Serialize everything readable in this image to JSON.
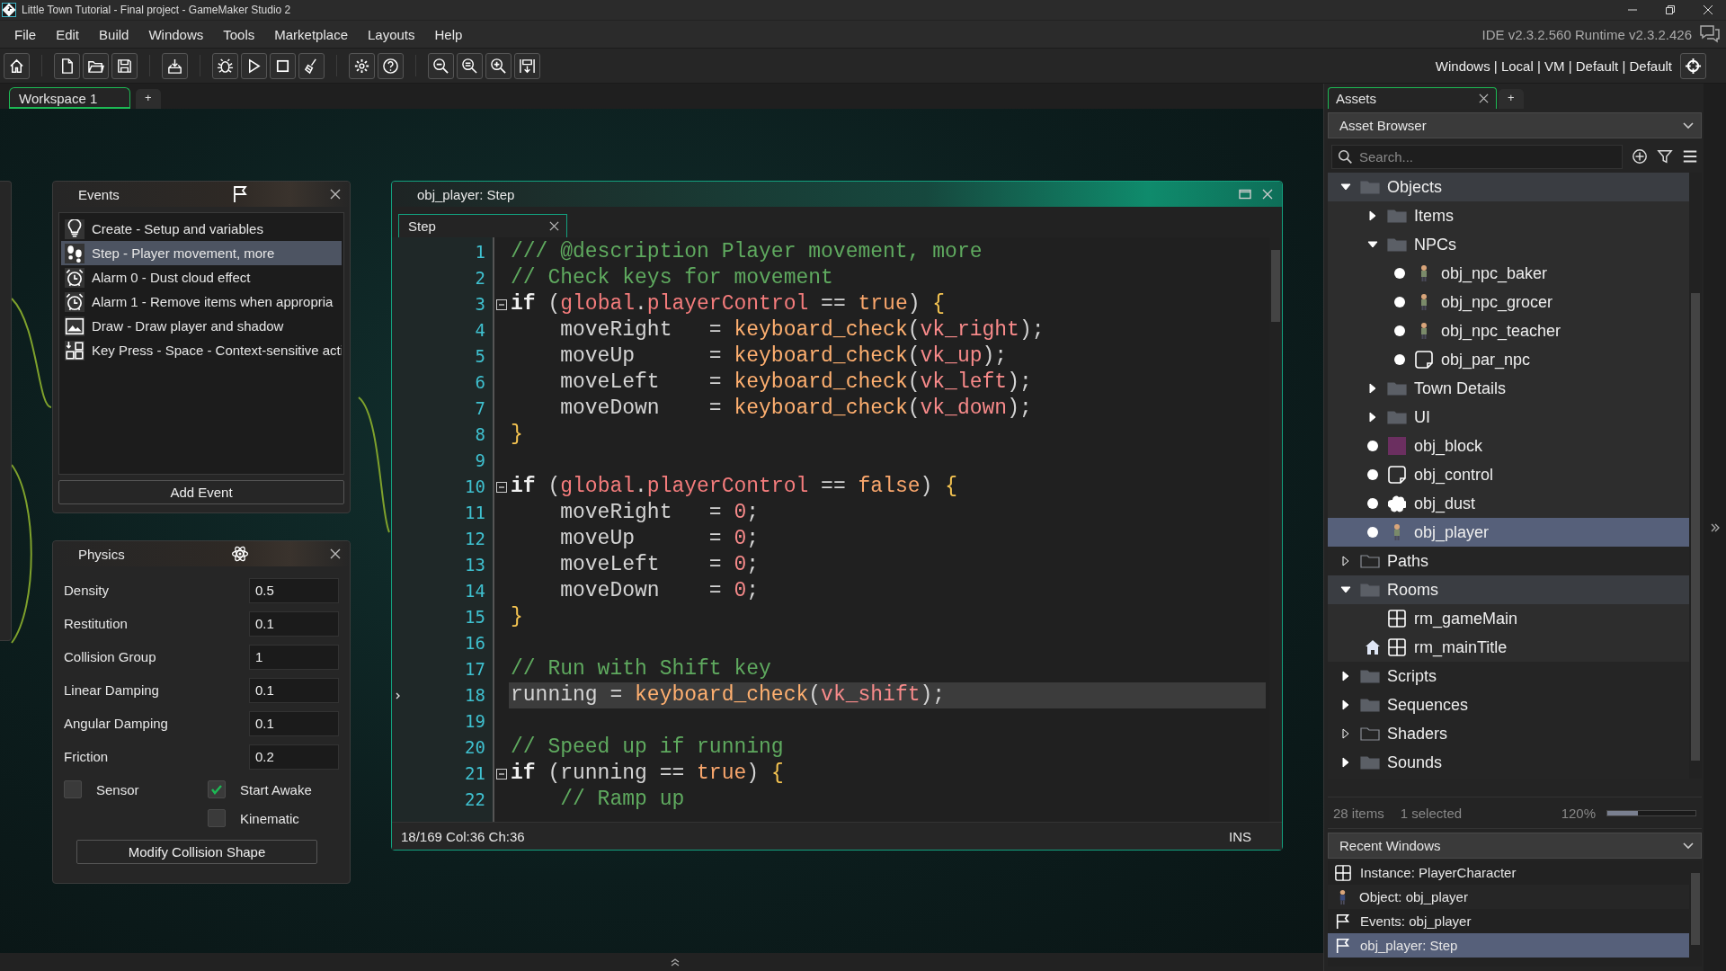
{
  "window": {
    "title": "Little Town Tutorial - Final project - GameMaker Studio 2"
  },
  "menu": [
    "File",
    "Edit",
    "Build",
    "Windows",
    "Tools",
    "Marketplace",
    "Layouts",
    "Help"
  ],
  "version": "IDE v2.3.2.560  Runtime v2.3.2.426",
  "target": "Windows | Local | VM | Default | Default",
  "workspace": {
    "tabs": [
      {
        "label": "Workspace 1",
        "selected": true
      }
    ],
    "add_tab": "+"
  },
  "events": {
    "title": "Events",
    "items": [
      {
        "label": "Create - Setup and variables",
        "kind": "create",
        "selected": false
      },
      {
        "label": "Step - Player movement, more",
        "kind": "step",
        "selected": true
      },
      {
        "label": "Alarm 0 - Dust cloud effect",
        "kind": "alarm",
        "selected": false
      },
      {
        "label": "Alarm 1 - Remove items when appropria",
        "kind": "alarm",
        "selected": false
      },
      {
        "label": "Draw - Draw player and shadow",
        "kind": "draw",
        "selected": false
      },
      {
        "label": "Key Press - Space - Context-sensitive acti",
        "kind": "keypress",
        "selected": false
      }
    ],
    "add_button": "Add Event"
  },
  "physics": {
    "title": "Physics",
    "fields": [
      {
        "label": "Density",
        "value": "0.5"
      },
      {
        "label": "Restitution",
        "value": "0.1"
      },
      {
        "label": "Collision Group",
        "value": "1"
      },
      {
        "label": "Linear Damping",
        "value": "0.1"
      },
      {
        "label": "Angular Damping",
        "value": "0.1"
      },
      {
        "label": "Friction",
        "value": "0.2"
      }
    ],
    "checkboxes": [
      {
        "label": "Sensor",
        "checked": false
      },
      {
        "label": "Start Awake",
        "checked": true
      },
      {
        "label": "Kinematic",
        "checked": false
      }
    ],
    "button": "Modify Collision Shape"
  },
  "editor": {
    "title": "obj_player: Step",
    "tabs": [
      {
        "label": "Step",
        "selected": true
      }
    ],
    "lines": [
      {
        "n": "1",
        "fold": false,
        "current": false,
        "tokens": [
          {
            "text": "/// @description Player movement, more",
            "kind": "comment"
          }
        ]
      },
      {
        "n": "2",
        "fold": false,
        "current": false,
        "tokens": [
          {
            "text": "// Check keys for movement",
            "kind": "comment"
          }
        ]
      },
      {
        "n": "3",
        "fold": true,
        "current": false,
        "tokens": [
          {
            "text": "if",
            "kind": "keyword"
          },
          {
            "text": " (",
            "kind": "plain"
          },
          {
            "text": "global",
            "kind": "global"
          },
          {
            "text": ".",
            "kind": "plain"
          },
          {
            "text": "playerControl",
            "kind": "global"
          },
          {
            "text": " == ",
            "kind": "plain"
          },
          {
            "text": "true",
            "kind": "bool"
          },
          {
            "text": ") ",
            "kind": "plain"
          },
          {
            "text": "{",
            "kind": "brace"
          }
        ]
      },
      {
        "n": "4",
        "fold": false,
        "current": false,
        "tokens": [
          {
            "text": "    moveRight   = ",
            "kind": "plain"
          },
          {
            "text": "keyboard_check",
            "kind": "function"
          },
          {
            "text": "(",
            "kind": "plain"
          },
          {
            "text": "vk_right",
            "kind": "constant"
          },
          {
            "text": ");",
            "kind": "plain"
          }
        ]
      },
      {
        "n": "5",
        "fold": false,
        "current": false,
        "tokens": [
          {
            "text": "    moveUp      = ",
            "kind": "plain"
          },
          {
            "text": "keyboard_check",
            "kind": "function"
          },
          {
            "text": "(",
            "kind": "plain"
          },
          {
            "text": "vk_up",
            "kind": "constant"
          },
          {
            "text": ");",
            "kind": "plain"
          }
        ]
      },
      {
        "n": "6",
        "fold": false,
        "current": false,
        "tokens": [
          {
            "text": "    moveLeft    = ",
            "kind": "plain"
          },
          {
            "text": "keyboard_check",
            "kind": "function"
          },
          {
            "text": "(",
            "kind": "plain"
          },
          {
            "text": "vk_left",
            "kind": "constant"
          },
          {
            "text": ");",
            "kind": "plain"
          }
        ]
      },
      {
        "n": "7",
        "fold": false,
        "current": false,
        "tokens": [
          {
            "text": "    moveDown    = ",
            "kind": "plain"
          },
          {
            "text": "keyboard_check",
            "kind": "function"
          },
          {
            "text": "(",
            "kind": "plain"
          },
          {
            "text": "vk_down",
            "kind": "constant"
          },
          {
            "text": ");",
            "kind": "plain"
          }
        ]
      },
      {
        "n": "8",
        "fold": false,
        "current": false,
        "tokens": [
          {
            "text": "}",
            "kind": "brace"
          }
        ]
      },
      {
        "n": "9",
        "fold": false,
        "current": false
      },
      {
        "n": "10",
        "fold": true,
        "current": false,
        "tokens": [
          {
            "text": "if",
            "kind": "keyword"
          },
          {
            "text": " (",
            "kind": "plain"
          },
          {
            "text": "global",
            "kind": "global"
          },
          {
            "text": ".",
            "kind": "plain"
          },
          {
            "text": "playerControl",
            "kind": "global"
          },
          {
            "text": " == ",
            "kind": "plain"
          },
          {
            "text": "false",
            "kind": "bool"
          },
          {
            "text": ") ",
            "kind": "plain"
          },
          {
            "text": "{",
            "kind": "brace"
          }
        ]
      },
      {
        "n": "11",
        "fold": false,
        "current": false,
        "tokens": [
          {
            "text": "    moveRight   = ",
            "kind": "plain"
          },
          {
            "text": "0",
            "kind": "number"
          },
          {
            "text": ";",
            "kind": "plain"
          }
        ]
      },
      {
        "n": "12",
        "fold": false,
        "current": false,
        "tokens": [
          {
            "text": "    moveUp      = ",
            "kind": "plain"
          },
          {
            "text": "0",
            "kind": "number"
          },
          {
            "text": ";",
            "kind": "plain"
          }
        ]
      },
      {
        "n": "13",
        "fold": false,
        "current": false,
        "tokens": [
          {
            "text": "    moveLeft    = ",
            "kind": "plain"
          },
          {
            "text": "0",
            "kind": "number"
          },
          {
            "text": ";",
            "kind": "plain"
          }
        ]
      },
      {
        "n": "14",
        "fold": false,
        "current": false,
        "tokens": [
          {
            "text": "    moveDown    = ",
            "kind": "plain"
          },
          {
            "text": "0",
            "kind": "number"
          },
          {
            "text": ";",
            "kind": "plain"
          }
        ]
      },
      {
        "n": "15",
        "fold": false,
        "current": false,
        "tokens": [
          {
            "text": "}",
            "kind": "brace"
          }
        ]
      },
      {
        "n": "16",
        "fold": false,
        "current": false
      },
      {
        "n": "17",
        "fold": false,
        "current": false,
        "tokens": [
          {
            "text": "// Run with Shift key",
            "kind": "comment"
          }
        ]
      },
      {
        "n": "18",
        "fold": false,
        "current": true,
        "tokens": [
          {
            "text": "running = ",
            "kind": "plain"
          },
          {
            "text": "keyboard_check",
            "kind": "function"
          },
          {
            "text": "(",
            "kind": "plain"
          },
          {
            "text": "vk_shift",
            "kind": "constant"
          },
          {
            "text": ");",
            "kind": "plain"
          }
        ]
      },
      {
        "n": "19",
        "fold": false,
        "current": false
      },
      {
        "n": "20",
        "fold": false,
        "current": false,
        "tokens": [
          {
            "text": "// Speed up if running",
            "kind": "comment"
          }
        ]
      },
      {
        "n": "21",
        "fold": true,
        "current": false,
        "tokens": [
          {
            "text": "if",
            "kind": "keyword"
          },
          {
            "text": " (running == ",
            "kind": "plain"
          },
          {
            "text": "true",
            "kind": "bool"
          },
          {
            "text": ") ",
            "kind": "plain"
          },
          {
            "text": "{",
            "kind": "brace"
          }
        ]
      },
      {
        "n": "22",
        "fold": false,
        "current": false,
        "tokens": [
          {
            "text": "    // Ramp up",
            "kind": "comment"
          }
        ]
      }
    ],
    "status": "18/169 Col:36 Ch:36",
    "mode": "INS"
  },
  "assets": {
    "tabs": [
      {
        "label": "Assets",
        "selected": true
      }
    ],
    "add_tab": "+",
    "view": "Asset Browser",
    "search_placeholder": "Search...",
    "tree": [
      {
        "label": "Objects",
        "kind": "folder",
        "expanded": true,
        "empty": false,
        "selected": false,
        "children": [
          {
            "label": "Items",
            "kind": "folder",
            "expanded": false,
            "empty": false,
            "selected": false
          },
          {
            "label": "NPCs",
            "kind": "folder",
            "expanded": true,
            "empty": false,
            "selected": false,
            "children": [
              {
                "label": "obj_npc_baker",
                "kind": "character",
                "selected": false
              },
              {
                "label": "obj_npc_grocer",
                "kind": "character",
                "selected": false
              },
              {
                "label": "obj_npc_teacher",
                "kind": "character",
                "selected": false
              },
              {
                "label": "obj_par_npc",
                "kind": "blank_object",
                "selected": false
              }
            ]
          },
          {
            "label": "Town Details",
            "kind": "folder",
            "expanded": false,
            "empty": false,
            "selected": false
          },
          {
            "label": "UI",
            "kind": "folder",
            "expanded": false,
            "empty": false,
            "selected": false
          },
          {
            "label": "obj_block",
            "kind": "block_object",
            "selected": false
          },
          {
            "label": "obj_control",
            "kind": "blank_object",
            "selected": false
          },
          {
            "label": "obj_dust",
            "kind": "cloud_object",
            "selected": false
          },
          {
            "label": "obj_player",
            "kind": "character",
            "selected": true
          }
        ]
      },
      {
        "label": "Paths",
        "kind": "folder",
        "expanded": false,
        "empty": true,
        "selected": false
      },
      {
        "label": "Rooms",
        "kind": "folder",
        "expanded": true,
        "empty": false,
        "selected": false,
        "children": [
          {
            "label": "rm_gameMain",
            "kind": "room",
            "start_room": false,
            "selected": false
          },
          {
            "label": "rm_mainTitle",
            "kind": "room",
            "start_room": true,
            "selected": false
          }
        ]
      },
      {
        "label": "Scripts",
        "kind": "folder",
        "expanded": false,
        "empty": false,
        "selected": false
      },
      {
        "label": "Sequences",
        "kind": "folder",
        "expanded": false,
        "empty": false,
        "selected": false
      },
      {
        "label": "Shaders",
        "kind": "folder",
        "expanded": false,
        "empty": true,
        "selected": false
      },
      {
        "label": "Sounds",
        "kind": "folder",
        "expanded": false,
        "empty": false,
        "selected": false
      }
    ],
    "status": {
      "count": "28 items",
      "selection": "1 selected",
      "zoom": "120%",
      "level": 0.35
    }
  },
  "recent": {
    "title": "Recent Windows",
    "items": [
      {
        "label": "Instance: PlayerCharacter",
        "kind": "instance",
        "selected": false
      },
      {
        "label": "Object: obj_player",
        "kind": "object",
        "selected": false
      },
      {
        "label": "Events: obj_player",
        "kind": "events",
        "selected": false
      },
      {
        "label": "obj_player: Step",
        "kind": "events",
        "selected": true
      }
    ]
  }
}
